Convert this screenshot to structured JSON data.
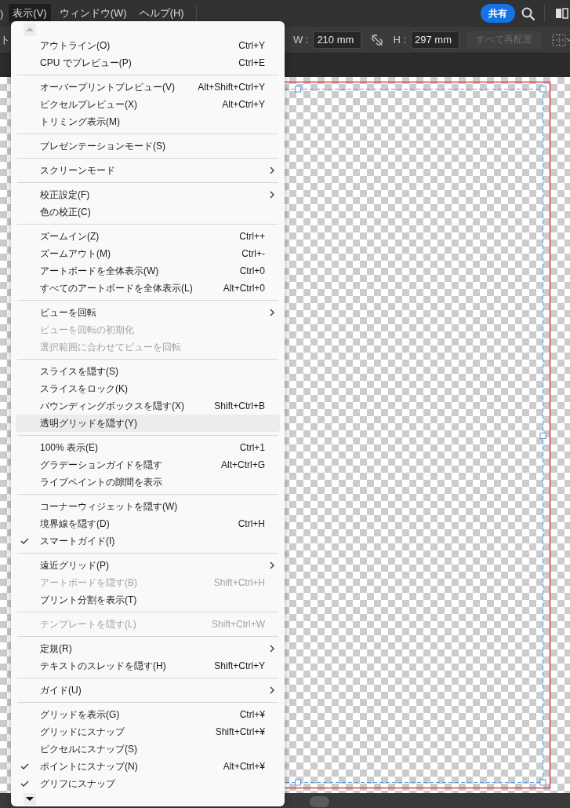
{
  "menubar": {
    "items": [
      {
        "label": ")",
        "selected": false
      },
      {
        "label": "表示(V)",
        "selected": true
      },
      {
        "label": "ウィンドウ(W)",
        "selected": false
      },
      {
        "label": "ヘルプ(H)",
        "selected": false
      }
    ],
    "share_button": "共有"
  },
  "toolbar": {
    "partial_label": "ト",
    "width_label": "W :",
    "width_value": "210 mm",
    "height_label": "H :",
    "height_value": "297 mm",
    "arrange_button": {
      "label": "すべて再配置",
      "disabled": true
    }
  },
  "menu": {
    "groups": [
      [
        {
          "label": "アウトライン(O)",
          "shortcut": "Ctrl+Y",
          "submenu": false,
          "checked": false,
          "disabled": false,
          "highlighted": false
        },
        {
          "label": "CPU でプレビュー(P)",
          "shortcut": "Ctrl+E",
          "submenu": false,
          "checked": false,
          "disabled": false,
          "highlighted": false
        }
      ],
      [
        {
          "label": "オーバープリントプレビュー(V)",
          "shortcut": "Alt+Shift+Ctrl+Y",
          "submenu": false,
          "checked": false,
          "disabled": false,
          "highlighted": false
        },
        {
          "label": "ピクセルプレビュー(X)",
          "shortcut": "Alt+Ctrl+Y",
          "submenu": false,
          "checked": false,
          "disabled": false,
          "highlighted": false
        },
        {
          "label": "トリミング表示(M)",
          "submenu": false,
          "checked": false,
          "disabled": false,
          "highlighted": false
        }
      ],
      [
        {
          "label": "プレゼンテーションモード(S)",
          "submenu": false,
          "checked": false,
          "disabled": false,
          "highlighted": false
        }
      ],
      [
        {
          "label": "スクリーンモード",
          "submenu": true,
          "checked": false,
          "disabled": false,
          "highlighted": false
        }
      ],
      [
        {
          "label": "校正設定(F)",
          "submenu": true,
          "checked": false,
          "disabled": false,
          "highlighted": false
        },
        {
          "label": "色の校正(C)",
          "submenu": false,
          "checked": false,
          "disabled": false,
          "highlighted": false
        }
      ],
      [
        {
          "label": "ズームイン(Z)",
          "shortcut": "Ctrl++",
          "submenu": false,
          "checked": false,
          "disabled": false,
          "highlighted": false
        },
        {
          "label": "ズームアウト(M)",
          "shortcut": "Ctrl+-",
          "submenu": false,
          "checked": false,
          "disabled": false,
          "highlighted": false
        },
        {
          "label": "アートボードを全体表示(W)",
          "shortcut": "Ctrl+0",
          "submenu": false,
          "checked": false,
          "disabled": false,
          "highlighted": false
        },
        {
          "label": "すべてのアートボードを全体表示(L)",
          "shortcut": "Alt+Ctrl+0",
          "submenu": false,
          "checked": false,
          "disabled": false,
          "highlighted": false
        }
      ],
      [
        {
          "label": "ビューを回転",
          "submenu": true,
          "checked": false,
          "disabled": false,
          "highlighted": false
        },
        {
          "label": "ビューを回転の初期化",
          "submenu": false,
          "checked": false,
          "disabled": true,
          "highlighted": false
        },
        {
          "label": "選択範囲に合わせてビューを回転",
          "submenu": false,
          "checked": false,
          "disabled": true,
          "highlighted": false
        }
      ],
      [
        {
          "label": "スライスを隠す(S)",
          "submenu": false,
          "checked": false,
          "disabled": false,
          "highlighted": false
        },
        {
          "label": "スライスをロック(K)",
          "submenu": false,
          "checked": false,
          "disabled": false,
          "highlighted": false
        },
        {
          "label": "バウンディングボックスを隠す(X)",
          "shortcut": "Shift+Ctrl+B",
          "submenu": false,
          "checked": false,
          "disabled": false,
          "highlighted": false
        },
        {
          "label": "透明グリッドを隠す(Y)",
          "submenu": false,
          "checked": false,
          "disabled": false,
          "highlighted": true
        }
      ],
      [
        {
          "label": "100% 表示(E)",
          "shortcut": "Ctrl+1",
          "submenu": false,
          "checked": false,
          "disabled": false,
          "highlighted": false
        },
        {
          "label": "グラデーションガイドを隠す",
          "shortcut": "Alt+Ctrl+G",
          "submenu": false,
          "checked": false,
          "disabled": false,
          "highlighted": false
        },
        {
          "label": "ライブペイントの隙間を表示",
          "submenu": false,
          "checked": false,
          "disabled": false,
          "highlighted": false
        }
      ],
      [
        {
          "label": "コーナーウィジェットを隠す(W)",
          "submenu": false,
          "checked": false,
          "disabled": false,
          "highlighted": false
        },
        {
          "label": "境界線を隠す(D)",
          "shortcut": "Ctrl+H",
          "submenu": false,
          "checked": false,
          "disabled": false,
          "highlighted": false
        },
        {
          "label": "スマートガイド(I)",
          "submenu": false,
          "checked": true,
          "disabled": false,
          "highlighted": false
        }
      ],
      [
        {
          "label": "遠近グリッド(P)",
          "submenu": true,
          "checked": false,
          "disabled": false,
          "highlighted": false
        },
        {
          "label": "アートボードを隠す(B)",
          "shortcut": "Shift+Ctrl+H",
          "submenu": false,
          "checked": false,
          "disabled": true,
          "highlighted": false
        },
        {
          "label": "プリント分割を表示(T)",
          "submenu": false,
          "checked": false,
          "disabled": false,
          "highlighted": false
        }
      ],
      [
        {
          "label": "テンプレートを隠す(L)",
          "shortcut": "Shift+Ctrl+W",
          "submenu": false,
          "checked": false,
          "disabled": true,
          "highlighted": false
        }
      ],
      [
        {
          "label": "定規(R)",
          "submenu": true,
          "checked": false,
          "disabled": false,
          "highlighted": false
        },
        {
          "label": "テキストのスレッドを隠す(H)",
          "shortcut": "Shift+Ctrl+Y",
          "submenu": false,
          "checked": false,
          "disabled": false,
          "highlighted": false
        }
      ],
      [
        {
          "label": "ガイド(U)",
          "submenu": true,
          "checked": false,
          "disabled": false,
          "highlighted": false
        }
      ],
      [
        {
          "label": "グリッドを表示(G)",
          "shortcut": "Ctrl+¥",
          "submenu": false,
          "checked": false,
          "disabled": false,
          "highlighted": false
        },
        {
          "label": "グリッドにスナップ",
          "shortcut": "Shift+Ctrl+¥",
          "submenu": false,
          "checked": false,
          "disabled": false,
          "highlighted": false
        },
        {
          "label": "ピクセルにスナップ(S)",
          "submenu": false,
          "checked": false,
          "disabled": false,
          "highlighted": false
        },
        {
          "label": "ポイントにスナップ(N)",
          "shortcut": "Alt+Ctrl+¥",
          "submenu": false,
          "checked": true,
          "disabled": false,
          "highlighted": false
        },
        {
          "label": "グリフにスナップ",
          "submenu": false,
          "checked": true,
          "disabled": false,
          "highlighted": false
        }
      ]
    ]
  }
}
